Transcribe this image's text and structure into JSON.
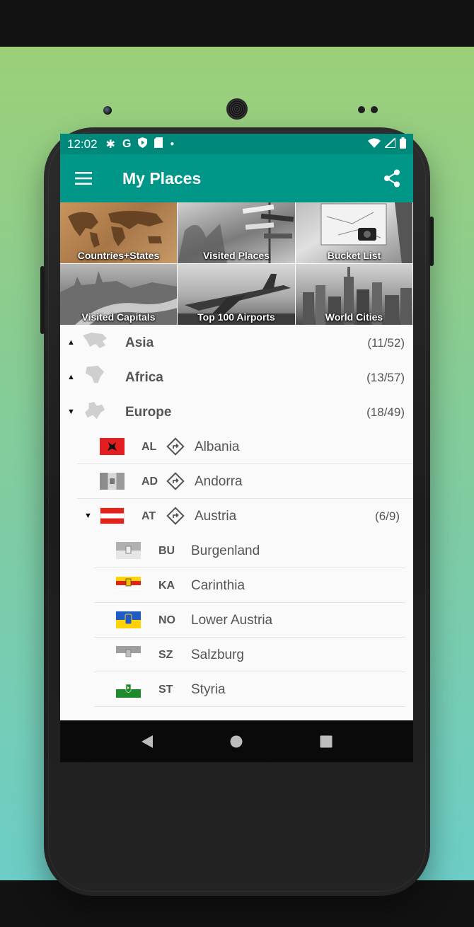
{
  "status_bar": {
    "time": "12:02",
    "left_icons": [
      "settings-icon",
      "google-icon",
      "shield-icon",
      "sd-card-icon",
      "dot-icon"
    ],
    "right_icons": [
      "wifi-icon",
      "signal-icon",
      "battery-icon"
    ]
  },
  "app_bar": {
    "title": "My Places",
    "menu_icon": "hamburger-menu-icon",
    "share_icon": "share-icon",
    "color": "#009688"
  },
  "tiles": [
    {
      "label": "Countries+States"
    },
    {
      "label": "Visited Places"
    },
    {
      "label": "Bucket List"
    },
    {
      "label": "Visited Capitals"
    },
    {
      "label": "Top 100 Airports"
    },
    {
      "label": "World Cities"
    }
  ],
  "continents": [
    {
      "name": "Asia",
      "count": "(11/52)",
      "expanded": false
    },
    {
      "name": "Africa",
      "count": "(13/57)",
      "expanded": false
    },
    {
      "name": "Europe",
      "count": "(18/49)",
      "expanded": true
    }
  ],
  "countries": [
    {
      "code": "AL",
      "name": "Albania",
      "count": ""
    },
    {
      "code": "AD",
      "name": "Andorra",
      "count": ""
    },
    {
      "code": "AT",
      "name": "Austria",
      "count": "(6/9)",
      "expanded": true
    }
  ],
  "states": [
    {
      "code": "BU",
      "name": "Burgenland"
    },
    {
      "code": "KA",
      "name": "Carinthia"
    },
    {
      "code": "NO",
      "name": "Lower Austria"
    },
    {
      "code": "SZ",
      "name": "Salzburg"
    },
    {
      "code": "ST",
      "name": "Styria"
    }
  ],
  "nav_bar": {
    "back_icon": "back-triangle-icon",
    "home_icon": "home-circle-icon",
    "recents_icon": "recents-square-icon"
  }
}
